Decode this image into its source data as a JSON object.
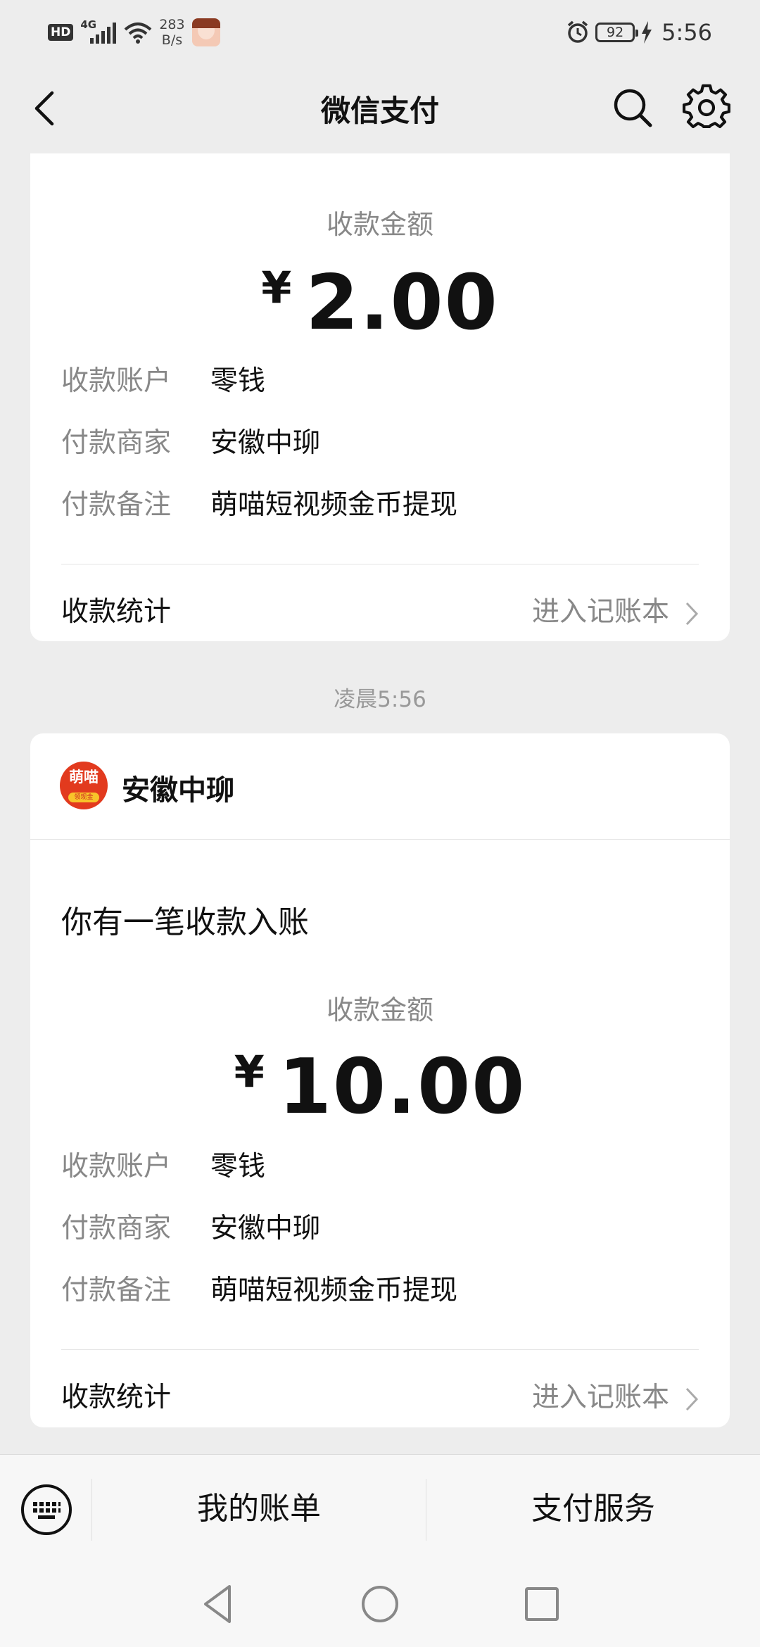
{
  "status_bar": {
    "hd": "HD",
    "network": "4G",
    "speed_value": "283",
    "speed_unit": "B/s",
    "battery": "92",
    "time": "5:56"
  },
  "nav": {
    "title": "微信支付"
  },
  "card1": {
    "amount_label": "收款金额",
    "currency": "¥",
    "amount": "2.00",
    "rows": [
      {
        "key": "收款账户",
        "value": "零钱"
      },
      {
        "key": "付款商家",
        "value": "安徽中珋"
      },
      {
        "key": "付款备注",
        "value": "萌喵短视频金币提现"
      }
    ],
    "stat_label": "收款统计",
    "stat_link": "进入记账本"
  },
  "timestamp": "凌晨5:56",
  "card2": {
    "merchant_name": "安徽中珋",
    "merchant_logo_text": "萌喵",
    "merchant_logo_sub": "领现金",
    "notice": "你有一笔收款入账",
    "amount_label": "收款金额",
    "currency": "¥",
    "amount": "10.00",
    "rows": [
      {
        "key": "收款账户",
        "value": "零钱"
      },
      {
        "key": "付款商家",
        "value": "安徽中珋"
      },
      {
        "key": "付款备注",
        "value": "萌喵短视频金币提现"
      }
    ],
    "stat_label": "收款统计",
    "stat_link": "进入记账本"
  },
  "bottom_menu": {
    "items": [
      "我的账单",
      "支付服务"
    ]
  },
  "icons": {
    "back": "chevron-left-icon",
    "search": "search-icon",
    "settings": "gear-icon",
    "keyboard": "keyboard-icon",
    "sys_back": "triangle-back-icon",
    "sys_home": "circle-home-icon",
    "sys_recent": "square-recent-icon"
  }
}
